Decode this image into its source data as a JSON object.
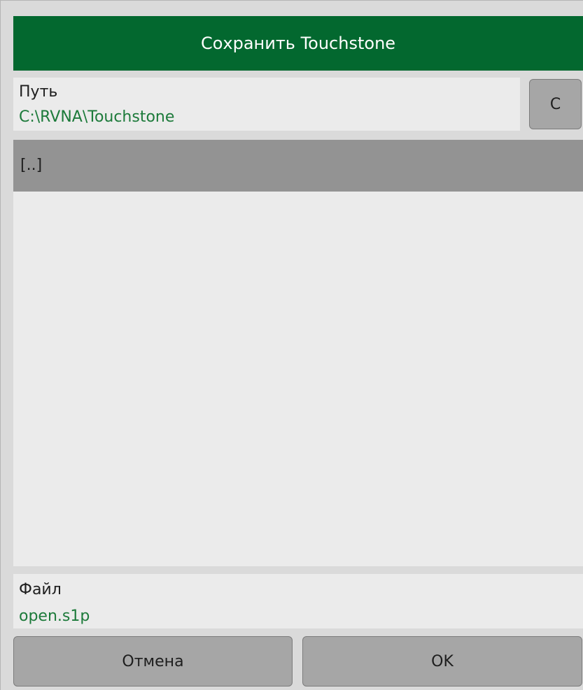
{
  "dialog": {
    "title": "Сохранить Touchstone",
    "path": {
      "label": "Путь",
      "value": "C:\\RVNA\\Touchstone"
    },
    "drive_button_label": "C",
    "file_list": {
      "items": [
        {
          "label": "[..]"
        }
      ]
    },
    "file": {
      "label": "Файл",
      "value": "open.s1p"
    },
    "buttons": {
      "cancel_label": "Отмена",
      "ok_label": "OK"
    }
  }
}
